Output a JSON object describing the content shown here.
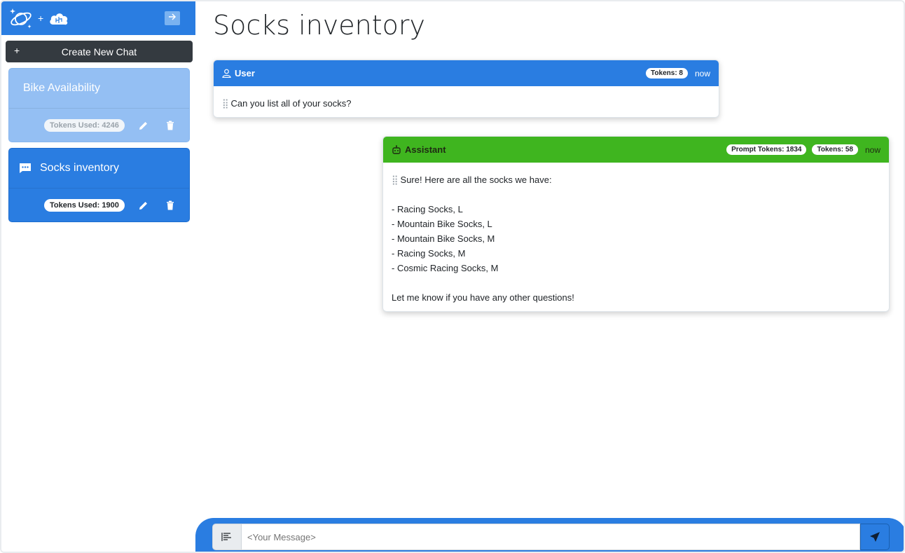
{
  "sidebar": {
    "new_chat_plus": "+",
    "new_chat_label": "Create New Chat",
    "chats": [
      {
        "title": "Bike Availability",
        "tokens": "Tokens Used: 4246",
        "active": false
      },
      {
        "title": "Socks inventory",
        "tokens": "Tokens Used: 1900",
        "active": true
      }
    ]
  },
  "main": {
    "title": "Socks inventory",
    "messages": [
      {
        "role": "User",
        "badges": [
          "Tokens: 8"
        ],
        "time": "now",
        "text": "Can you list all of your socks?"
      },
      {
        "role": "Assistant",
        "badges": [
          "Prompt Tokens: 1834",
          "Tokens: 58"
        ],
        "time": "now",
        "text": "Sure! Here are all the socks we have:\n\n- Racing Socks, L\n- Mountain Bike Socks, L\n- Mountain Bike Socks, M\n- Racing Socks, M\n- Cosmic Racing Socks, M\n\nLet me know if you have any other questions!"
      }
    ]
  },
  "input": {
    "placeholder": "<Your Message>",
    "value": ""
  },
  "colors": {
    "primary": "#2a7de1",
    "assistant": "#3fb51f",
    "dark_button": "#343a40",
    "inactive_card": "#94bff3"
  },
  "icons": {
    "logo": "planet-sparkle-icon",
    "logo_secondary": "cloud-brain-icon",
    "collapse": "arrow-right-icon",
    "chat": "chat-bubble-icon",
    "edit": "pencil-icon",
    "delete": "trash-icon",
    "user": "person-icon",
    "assistant": "robot-icon",
    "prompt": "text-lines-icon",
    "send": "send-icon"
  }
}
